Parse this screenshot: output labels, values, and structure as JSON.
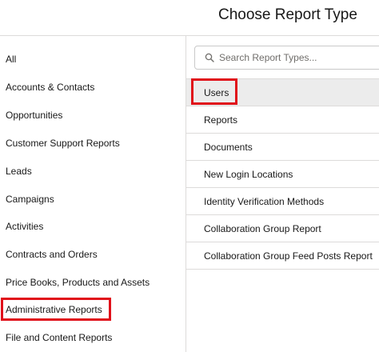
{
  "header": {
    "title": "Choose Report Type"
  },
  "search": {
    "placeholder": "Search Report Types..."
  },
  "categories": [
    "All",
    "Accounts & Contacts",
    "Opportunities",
    "Customer Support Reports",
    "Leads",
    "Campaigns",
    "Activities",
    "Contracts and Orders",
    "Price Books, Products and Assets",
    "Administrative Reports",
    "File and Content Reports"
  ],
  "report_types": [
    "Users",
    "Reports",
    "Documents",
    "New Login Locations",
    "Identity Verification Methods",
    "Collaboration Group Report",
    "Collaboration Group Feed Posts Report"
  ],
  "colors": {
    "highlight": "#e0101a",
    "border": "#dddbda",
    "selected_row": "#ececec"
  }
}
